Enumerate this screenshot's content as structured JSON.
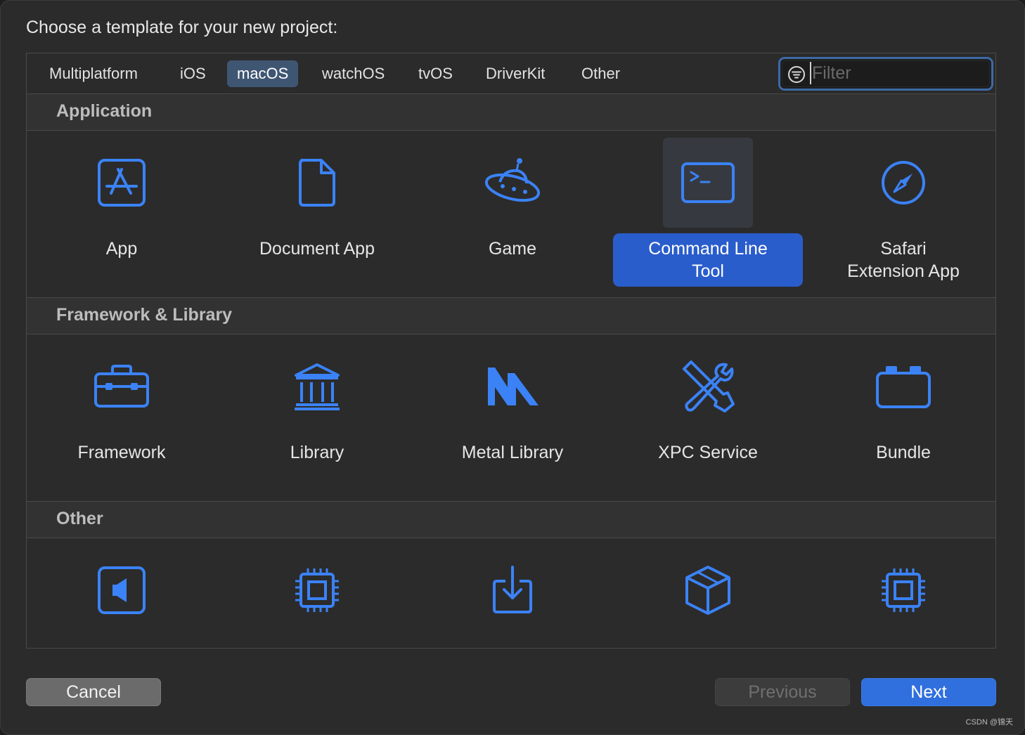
{
  "dialog": {
    "prompt": "Choose a template for your new project:"
  },
  "tabs": [
    {
      "label": "Multiplatform"
    },
    {
      "label": "iOS"
    },
    {
      "label": "macOS"
    },
    {
      "label": "watchOS"
    },
    {
      "label": "tvOS"
    },
    {
      "label": "DriverKit"
    },
    {
      "label": "Other"
    }
  ],
  "selected_tab": "macOS",
  "filter": {
    "placeholder": "Filter",
    "value": ""
  },
  "sections": [
    {
      "title": "Application",
      "items": [
        {
          "label": "App",
          "icon": "app-store-icon"
        },
        {
          "label": "Document App",
          "icon": "document-icon"
        },
        {
          "label": "Game",
          "icon": "ufo-icon"
        },
        {
          "label": "Command Line Tool",
          "icon": "terminal-icon",
          "selected": true
        },
        {
          "label": "Safari Extension App",
          "icon": "compass-icon"
        }
      ]
    },
    {
      "title": "Framework & Library",
      "items": [
        {
          "label": "Framework",
          "icon": "toolbox-icon"
        },
        {
          "label": "Library",
          "icon": "library-building-icon"
        },
        {
          "label": "Metal Library",
          "icon": "metal-icon"
        },
        {
          "label": "XPC Service",
          "icon": "tools-icon"
        },
        {
          "label": "Bundle",
          "icon": "bundle-icon"
        }
      ]
    },
    {
      "title": "Other",
      "items": [
        {
          "label": "",
          "icon": "audio-unit-icon"
        },
        {
          "label": "",
          "icon": "chip-icon"
        },
        {
          "label": "",
          "icon": "installer-icon"
        },
        {
          "label": "",
          "icon": "package-icon"
        },
        {
          "label": "",
          "icon": "chip-icon"
        }
      ]
    }
  ],
  "buttons": {
    "cancel": "Cancel",
    "previous": "Previous",
    "next": "Next"
  },
  "watermark": "CSDN @锦天",
  "colors": {
    "accent": "#2f6fde",
    "icon_blue": "#3b82f6",
    "selection": "#2a5dcc"
  }
}
